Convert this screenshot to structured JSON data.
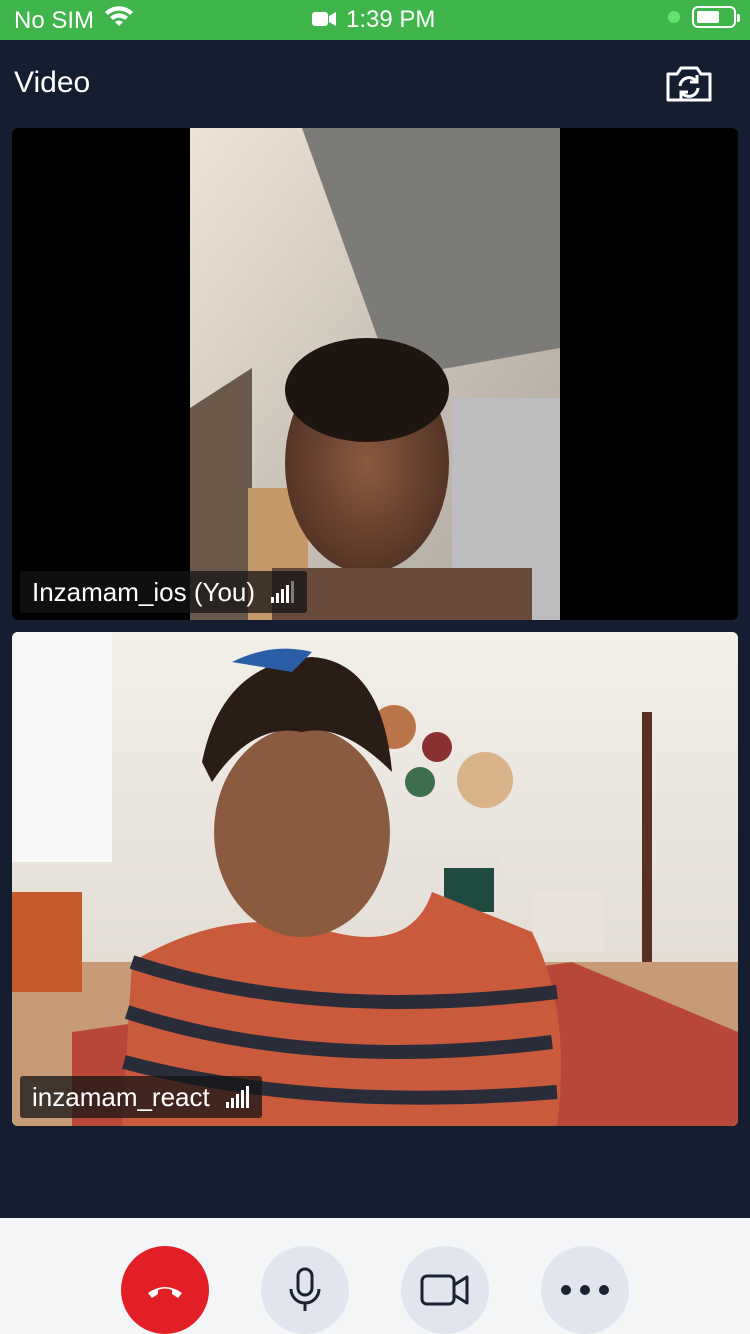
{
  "status_bar": {
    "carrier": "No SIM",
    "time": "1:39 PM",
    "battery_level": 0.6
  },
  "header": {
    "title": "Video"
  },
  "participants": [
    {
      "name": "Inzamam_ios (You)",
      "signal_bars": 4
    },
    {
      "name": "inzamam_react",
      "signal_bars": 5
    }
  ],
  "colors": {
    "status_bar": "#3fb54c",
    "background": "#141e30",
    "end_call": "#e21f26",
    "control_bg": "#e2e5ee",
    "bottom_bar": "#f4f5f7"
  },
  "controls": [
    {
      "icon": "phone-hangup-icon"
    },
    {
      "icon": "microphone-icon"
    },
    {
      "icon": "video-camera-icon"
    },
    {
      "icon": "more-icon"
    }
  ]
}
